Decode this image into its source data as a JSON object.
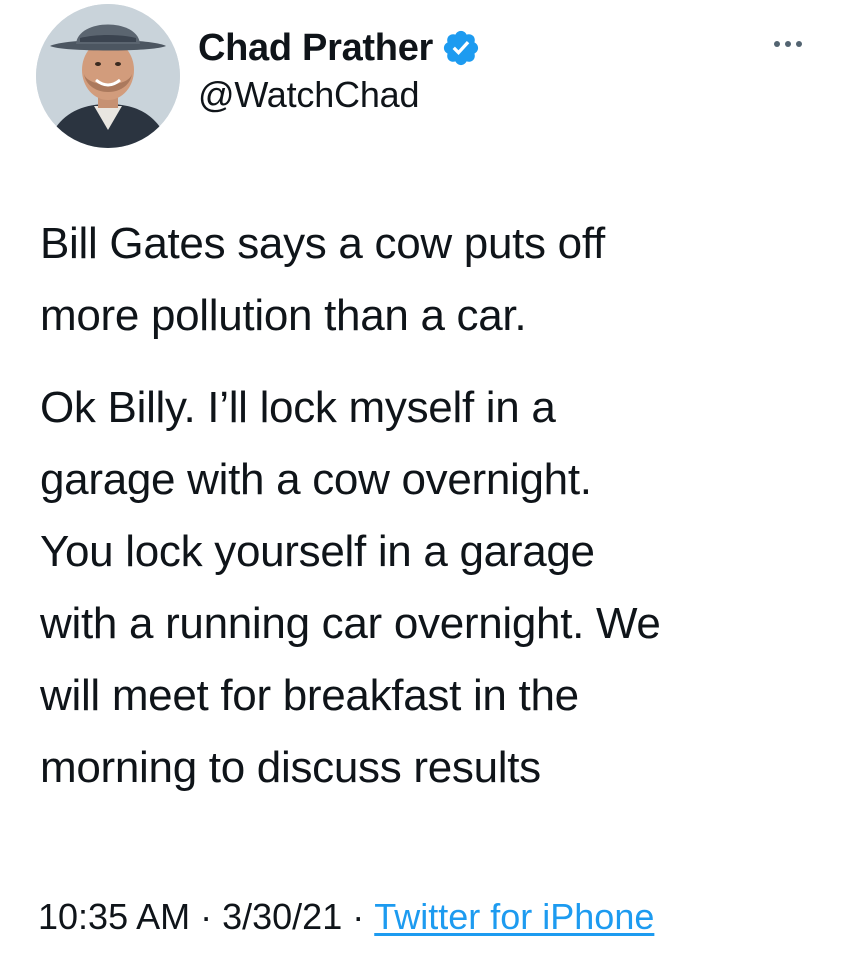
{
  "author": {
    "display_name": "Chad Prather",
    "handle": "@WatchChad",
    "verified_icon": "verified-badge-icon",
    "avatar_icon": "avatar"
  },
  "menu": {
    "more_icon": "more-options-icon"
  },
  "tweet": {
    "paragraphs": [
      "Bill Gates says a cow puts off\nmore pollution than a car.",
      "Ok Billy. I’ll lock myself in a\ngarage with a cow overnight.\nYou lock yourself in a garage\nwith a running car overnight. We\nwill meet for breakfast in the\nmorning to discuss results"
    ]
  },
  "meta": {
    "time": "10:35 AM",
    "separator": "·",
    "date": "3/30/21",
    "source": "Twitter for iPhone"
  },
  "colors": {
    "text": "#0f1419",
    "accent": "#1d9bf0",
    "muted": "#536471"
  }
}
